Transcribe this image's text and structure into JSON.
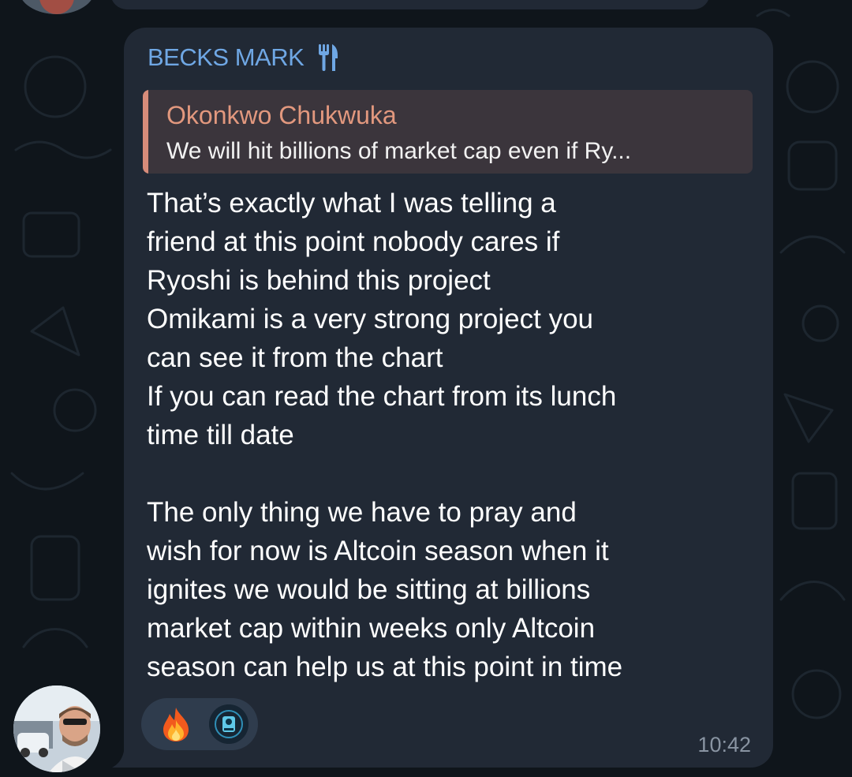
{
  "message": {
    "sender_name": "BECKS MARK",
    "sender_badge_icon": "fork-and-knife-icon",
    "reply": {
      "author": "Okonkwo Chukwuka",
      "preview": "We will hit billions of market cap even if Ry..."
    },
    "text": "That’s exactly what I was telling a\nfriend at this point nobody cares if\nRyoshi is behind this project\nOmikami is a very strong project you\ncan see it from the chart\nIf you can read the chart from its lunch\ntime till date\n\nThe only thing we have to pray and\nwish for now is Altcoin season when it\nignites we would be sitting at billions\nmarket cap within weeks  only Altcoin\nseason can help us at this point in time",
    "reactions": [
      {
        "icon": "fire-emoji"
      },
      {
        "icon": "user-avatar-reaction"
      }
    ],
    "time": "10:42"
  },
  "colors": {
    "background": "#0f151b",
    "bubble": "#212935",
    "sender_name": "#6fa7e4",
    "reply_author": "#e2987e",
    "reply_bar": "#d78c7a",
    "reply_bg": "#3b353c",
    "message_text": "#ffffff",
    "time_text": "#8994a2",
    "reaction_bg": "#2f3c4d"
  }
}
